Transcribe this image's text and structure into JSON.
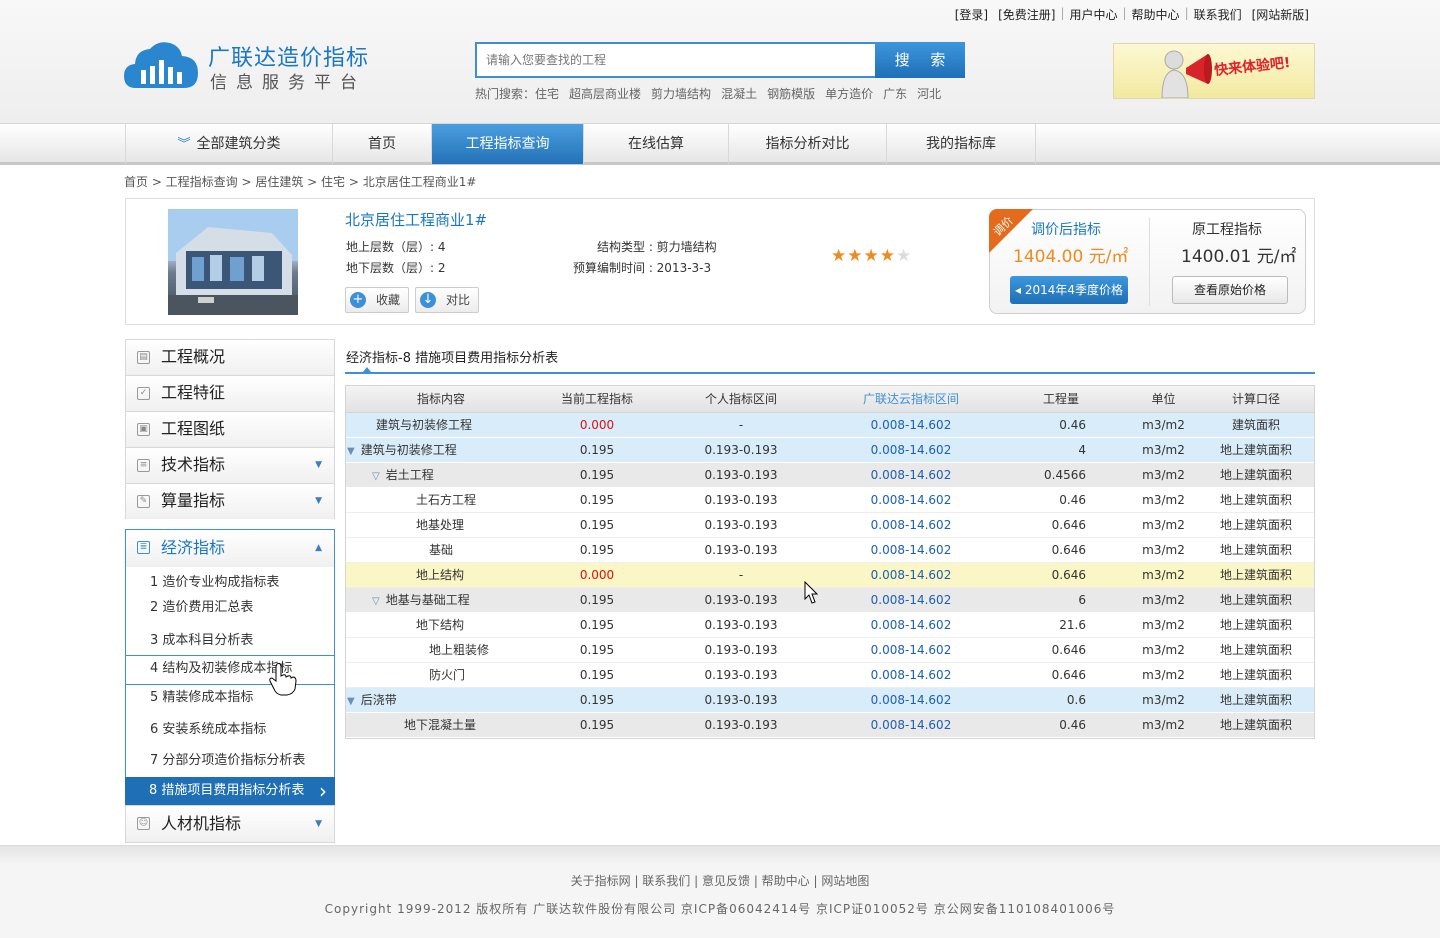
{
  "top_links": [
    "[登录]",
    "[免费注册]",
    "用户中心",
    "帮助中心",
    "联系我们",
    "[网站新版]"
  ],
  "logo": {
    "title": "广联达造价指标",
    "subtitle": "信息服务平台"
  },
  "search": {
    "placeholder": "请输入您要查找的工程",
    "button": "搜 索"
  },
  "hot_search": {
    "label": "热门搜索：",
    "items": [
      "住宅",
      "超高层商业楼",
      "剪力墙结构",
      "混凝土",
      "钢筋模版",
      "单方造价",
      "广东",
      "河北"
    ]
  },
  "banner": {
    "text": "快来体验吧!"
  },
  "nav": {
    "categories_label": "全部建筑分类",
    "items": [
      "首页",
      "工程指标查询",
      "在线估算",
      "指标分析对比",
      "我的指标库"
    ],
    "active": "工程指标查询"
  },
  "breadcrumb": "首页 > 工程指标查询 > 居住建筑 > 住宅 > 北京居住工程商业1#",
  "project": {
    "name": "北京居住工程商业1#",
    "floors_above": "地上层数（层）: 4",
    "floors_below": "地下层数（层）: 2",
    "structure": "结构类型 : 剪力墙结构",
    "budget_time": "预算编制时间 : 2013-3-3",
    "btn_collect": "收藏",
    "btn_compare": "对比",
    "rating": 4,
    "rating_max": 5
  },
  "price": {
    "ribbon": "调价",
    "adjusted_label": "调价后指标",
    "adjusted_value": "1404.00 元/㎡",
    "original_label": "原工程指标",
    "original_value": "1400.01 元/㎡",
    "season_button": "◂ 2014年4季度价格",
    "view_original_button": "查看原始价格",
    "accent": "#f08a1c"
  },
  "sidebar": {
    "menus": [
      {
        "label": "工程概况",
        "icon": "document-icon"
      },
      {
        "label": "工程特征",
        "icon": "check-icon"
      },
      {
        "label": "工程图纸",
        "icon": "image-icon"
      },
      {
        "label": "技术指标",
        "icon": "list-icon",
        "arrow": "▼"
      },
      {
        "label": "算量指标",
        "icon": "edit-icon",
        "arrow": "▼"
      }
    ],
    "open_menu": {
      "label": "经济指标",
      "icon": "database-icon",
      "arrow": "▲"
    },
    "sub_items": [
      "1 造价专业构成指标表",
      "2 造价费用汇总表",
      "3 成本科目分析表",
      "4 结构及初装修成本指标",
      "5 精装修成本指标",
      "6 安装系统成本指标",
      "7 分部分项造价指标分析表",
      "8 措施项目费用指标分析表"
    ],
    "last_menu": {
      "label": "人材机指标",
      "icon": "person-icon",
      "arrow": "▼"
    }
  },
  "main": {
    "title": "经济指标-8 措施项目费用指标分析表",
    "columns": [
      "指标内容",
      "当前工程指标",
      "个人指标区间",
      "广联达云指标区间",
      "工程量",
      "单位",
      "计算口径"
    ],
    "rows": [
      {
        "name": "建筑与初装修工程",
        "cur": "0.000",
        "personal": "-",
        "cloud": "0.008-14.602",
        "qty": "0.46",
        "unit": "m3/m2",
        "basis": "建筑面积",
        "style": "blue",
        "indent": 0,
        "tri": "",
        "red": true
      },
      {
        "name": "建筑与初装修工程",
        "cur": "0.195",
        "personal": "0.193-0.193",
        "cloud": "0.008-14.602",
        "qty": "4",
        "unit": "m3/m2",
        "basis": "地上建筑面积",
        "style": "blue",
        "indent": 0,
        "tri": "▼",
        "red": false
      },
      {
        "name": "岩土工程",
        "cur": "0.195",
        "personal": "0.193-0.193",
        "cloud": "0.008-14.602",
        "qty": "0.4566",
        "unit": "m3/m2",
        "basis": "地上建筑面积",
        "style": "gray",
        "indent": 1,
        "tri": "▽",
        "red": false
      },
      {
        "name": "土石方工程",
        "cur": "0.195",
        "personal": "0.193-0.193",
        "cloud": "0.008-14.602",
        "qty": "0.46",
        "unit": "m3/m2",
        "basis": "地上建筑面积",
        "style": "white",
        "indent": 2,
        "tri": "",
        "red": false
      },
      {
        "name": "地基处理",
        "cur": "0.195",
        "personal": "0.193-0.193",
        "cloud": "0.008-14.602",
        "qty": "0.646",
        "unit": "m3/m2",
        "basis": "地上建筑面积",
        "style": "white",
        "indent": 2,
        "tri": "",
        "red": false
      },
      {
        "name": "基础",
        "cur": "0.195",
        "personal": "0.193-0.193",
        "cloud": "0.008-14.602",
        "qty": "0.646",
        "unit": "m3/m2",
        "basis": "地上建筑面积",
        "style": "white",
        "indent": 3,
        "tri": "",
        "red": false
      },
      {
        "name": "地上结构",
        "cur": "0.000",
        "personal": "-",
        "cloud": "0.008-14.602",
        "qty": "0.646",
        "unit": "m3/m2",
        "basis": "地上建筑面积",
        "style": "yellow",
        "indent": 2,
        "tri": "",
        "red": true
      },
      {
        "name": "地基与基础工程",
        "cur": "0.195",
        "personal": "0.193-0.193",
        "cloud": "0.008-14.602",
        "qty": "6",
        "unit": "m3/m2",
        "basis": "地上建筑面积",
        "style": "gray",
        "indent": 1,
        "tri": "▽",
        "red": false
      },
      {
        "name": "地下结构",
        "cur": "0.195",
        "personal": "0.193-0.193",
        "cloud": "0.008-14.602",
        "qty": "21.6",
        "unit": "m3/m2",
        "basis": "地上建筑面积",
        "style": "white",
        "indent": 2,
        "tri": "",
        "red": false
      },
      {
        "name": "地上粗装修",
        "cur": "0.195",
        "personal": "0.193-0.193",
        "cloud": "0.008-14.602",
        "qty": "0.646",
        "unit": "m3/m2",
        "basis": "地上建筑面积",
        "style": "white",
        "indent": 3,
        "tri": "",
        "red": false
      },
      {
        "name": "防火门",
        "cur": "0.195",
        "personal": "0.193-0.193",
        "cloud": "0.008-14.602",
        "qty": "0.646",
        "unit": "m3/m2",
        "basis": "地上建筑面积",
        "style": "white",
        "indent": 3,
        "tri": "",
        "red": false
      },
      {
        "name": "后浇带",
        "cur": "0.195",
        "personal": "0.193-0.193",
        "cloud": "0.008-14.602",
        "qty": "0.6",
        "unit": "m3/m2",
        "basis": "地上建筑面积",
        "style": "blue",
        "indent": 0,
        "tri": "▼",
        "red": false
      },
      {
        "name": "地下混凝土量",
        "cur": "0.195",
        "personal": "0.193-0.193",
        "cloud": "0.008-14.602",
        "qty": "0.46",
        "unit": "m3/m2",
        "basis": "地上建筑面积",
        "style": "gray",
        "indent": 1,
        "tri": "",
        "red": false
      }
    ]
  },
  "footer": {
    "links": [
      "关于指标网",
      "联系我们",
      "意见反馈",
      "帮助中心",
      "网站地图"
    ],
    "copyright": "Copyright 1999-2012 版权所有 广联达软件股份有限公司 京ICP备06042414号 京ICP证010052号 京公网安备110108401006号"
  },
  "colors": {
    "brand": "#1a78c2",
    "nav_active": "#2a7cc2",
    "red": "#e01010",
    "price_orange": "#f08a1c"
  }
}
